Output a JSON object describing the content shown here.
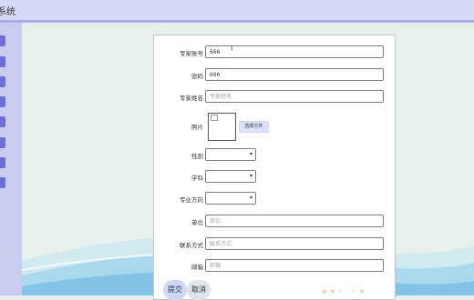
{
  "app": {
    "title": "系统"
  },
  "form": {
    "fields": {
      "account": {
        "label": "专家账号",
        "value": "666",
        "placeholder": ""
      },
      "password": {
        "label": "密码",
        "value": "666",
        "placeholder": ""
      },
      "name": {
        "label": "专家姓名",
        "value": "",
        "placeholder": "专家姓名"
      },
      "photo": {
        "label": "照片",
        "button": "选择文件"
      },
      "gender": {
        "label": "性别",
        "value": ""
      },
      "subject": {
        "label": "学科",
        "value": ""
      },
      "direction": {
        "label": "专业方向",
        "value": ""
      },
      "unit": {
        "label": "单位",
        "value": "",
        "placeholder": "单位"
      },
      "contact": {
        "label": "联系方式",
        "value": "",
        "placeholder": "联系方式"
      },
      "email": {
        "label": "邮箱",
        "value": "",
        "placeholder": "邮箱"
      }
    },
    "submit_label": "提交",
    "cancel_label": "取消"
  },
  "colors": {
    "header_bg": "#d6d9f3",
    "header_border": "#a9aee8",
    "sidebar_bg": "#c9ccef",
    "sidebar_tab": "#6c6fd6",
    "main_bg": "#e7f1ec",
    "submit_bg": "#cfd6fb",
    "cancel_bg": "#dde4ea"
  },
  "icons": {
    "select_arrow": "chevron-down-icon",
    "photo_preview": "broken-image-icon",
    "cursor": "text-cursor-icon"
  }
}
